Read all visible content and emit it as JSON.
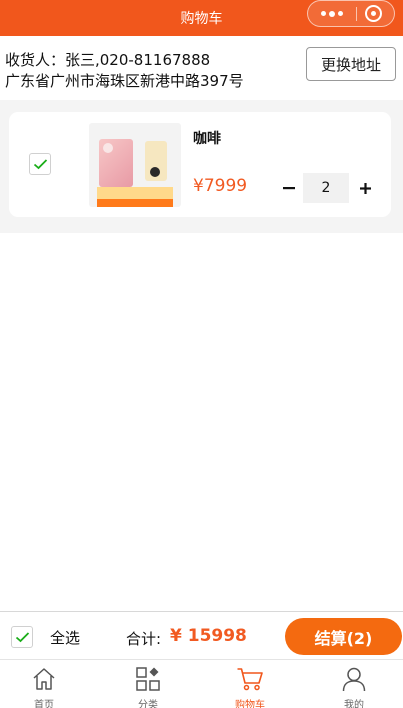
{
  "nav": {
    "title": "购物车"
  },
  "address": {
    "recipient_line": "收货人：张三,020-81167888",
    "address_line": "广东省广州市海珠区新港中路397号",
    "change_button_label": "更换地址"
  },
  "cart": {
    "items": [
      {
        "name": "咖啡",
        "price": "¥7999",
        "quantity": "2",
        "checked": true
      }
    ]
  },
  "summary": {
    "select_all_label": "全选",
    "total_label": "合计:",
    "total_amount": "¥ 15998",
    "checkout_label": "结算(2)"
  },
  "tabbar": {
    "tabs": [
      {
        "label": "首页",
        "icon": "home-icon",
        "active": false
      },
      {
        "label": "分类",
        "icon": "category-icon",
        "active": false
      },
      {
        "label": "购物车",
        "icon": "cart-icon",
        "active": true
      },
      {
        "label": "我的",
        "icon": "user-icon",
        "active": false
      }
    ]
  },
  "colors": {
    "accent": "#f1571c",
    "price": "#f15a22",
    "checkmark": "#1aad19"
  }
}
